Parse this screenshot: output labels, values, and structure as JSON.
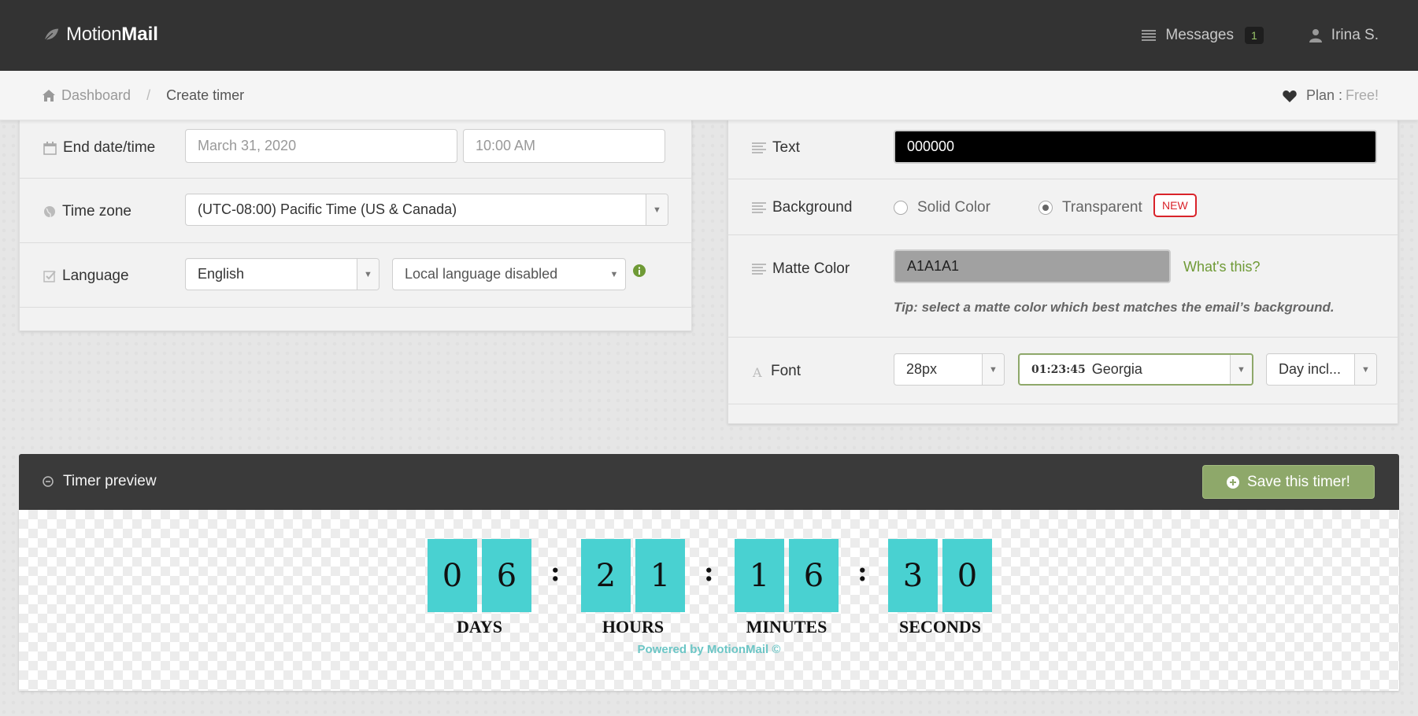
{
  "app": {
    "name_part1": "Motion",
    "name_part2": "Mail"
  },
  "header": {
    "messages_label": "Messages",
    "messages_count": "1",
    "user_name": "Irina S."
  },
  "breadcrumb": {
    "home": "Dashboard",
    "separator": "/",
    "current": "Create timer"
  },
  "plan": {
    "label": "Plan :",
    "value": "Free!"
  },
  "left": {
    "end_label": "End date/time",
    "end_date_placeholder": "March 31, 2020",
    "end_time_placeholder": "10:00 AM",
    "tz_label": "Time zone",
    "tz_value": "(UTC-08:00) Pacific Time (US & Canada)",
    "lang_label": "Language",
    "lang_value": "English",
    "local_value": "Local language disabled"
  },
  "right": {
    "text_label": "Text",
    "text_value": "000000",
    "bg_label": "Background",
    "bg_solid": "Solid Color",
    "bg_transparent": "Transparent",
    "bg_new": "NEW",
    "matte_label": "Matte Color",
    "matte_value": "A1A1A1",
    "matte_link": "What's this?",
    "matte_tip": "Tip: select a matte color which best matches the email’s background.",
    "font_label": "Font",
    "font_size": "28px",
    "font_sample": "01:23:45",
    "font_name": "Georgia",
    "font_day": "Day incl..."
  },
  "preview": {
    "title": "Timer preview",
    "save_label": "Save this timer!",
    "digits": [
      "0",
      "6",
      "2",
      "1",
      "1",
      "6",
      "3",
      "0"
    ],
    "colon": ":",
    "units": [
      "DAYS",
      "HOURS",
      "MINUTES",
      "SECONDS"
    ],
    "powered": "Powered by MotionMail ©"
  },
  "colors": {
    "topbar": "#333333",
    "accent_green": "#8ea86a",
    "digit_bg": "#49d1d1",
    "new_red": "#d9232a"
  }
}
